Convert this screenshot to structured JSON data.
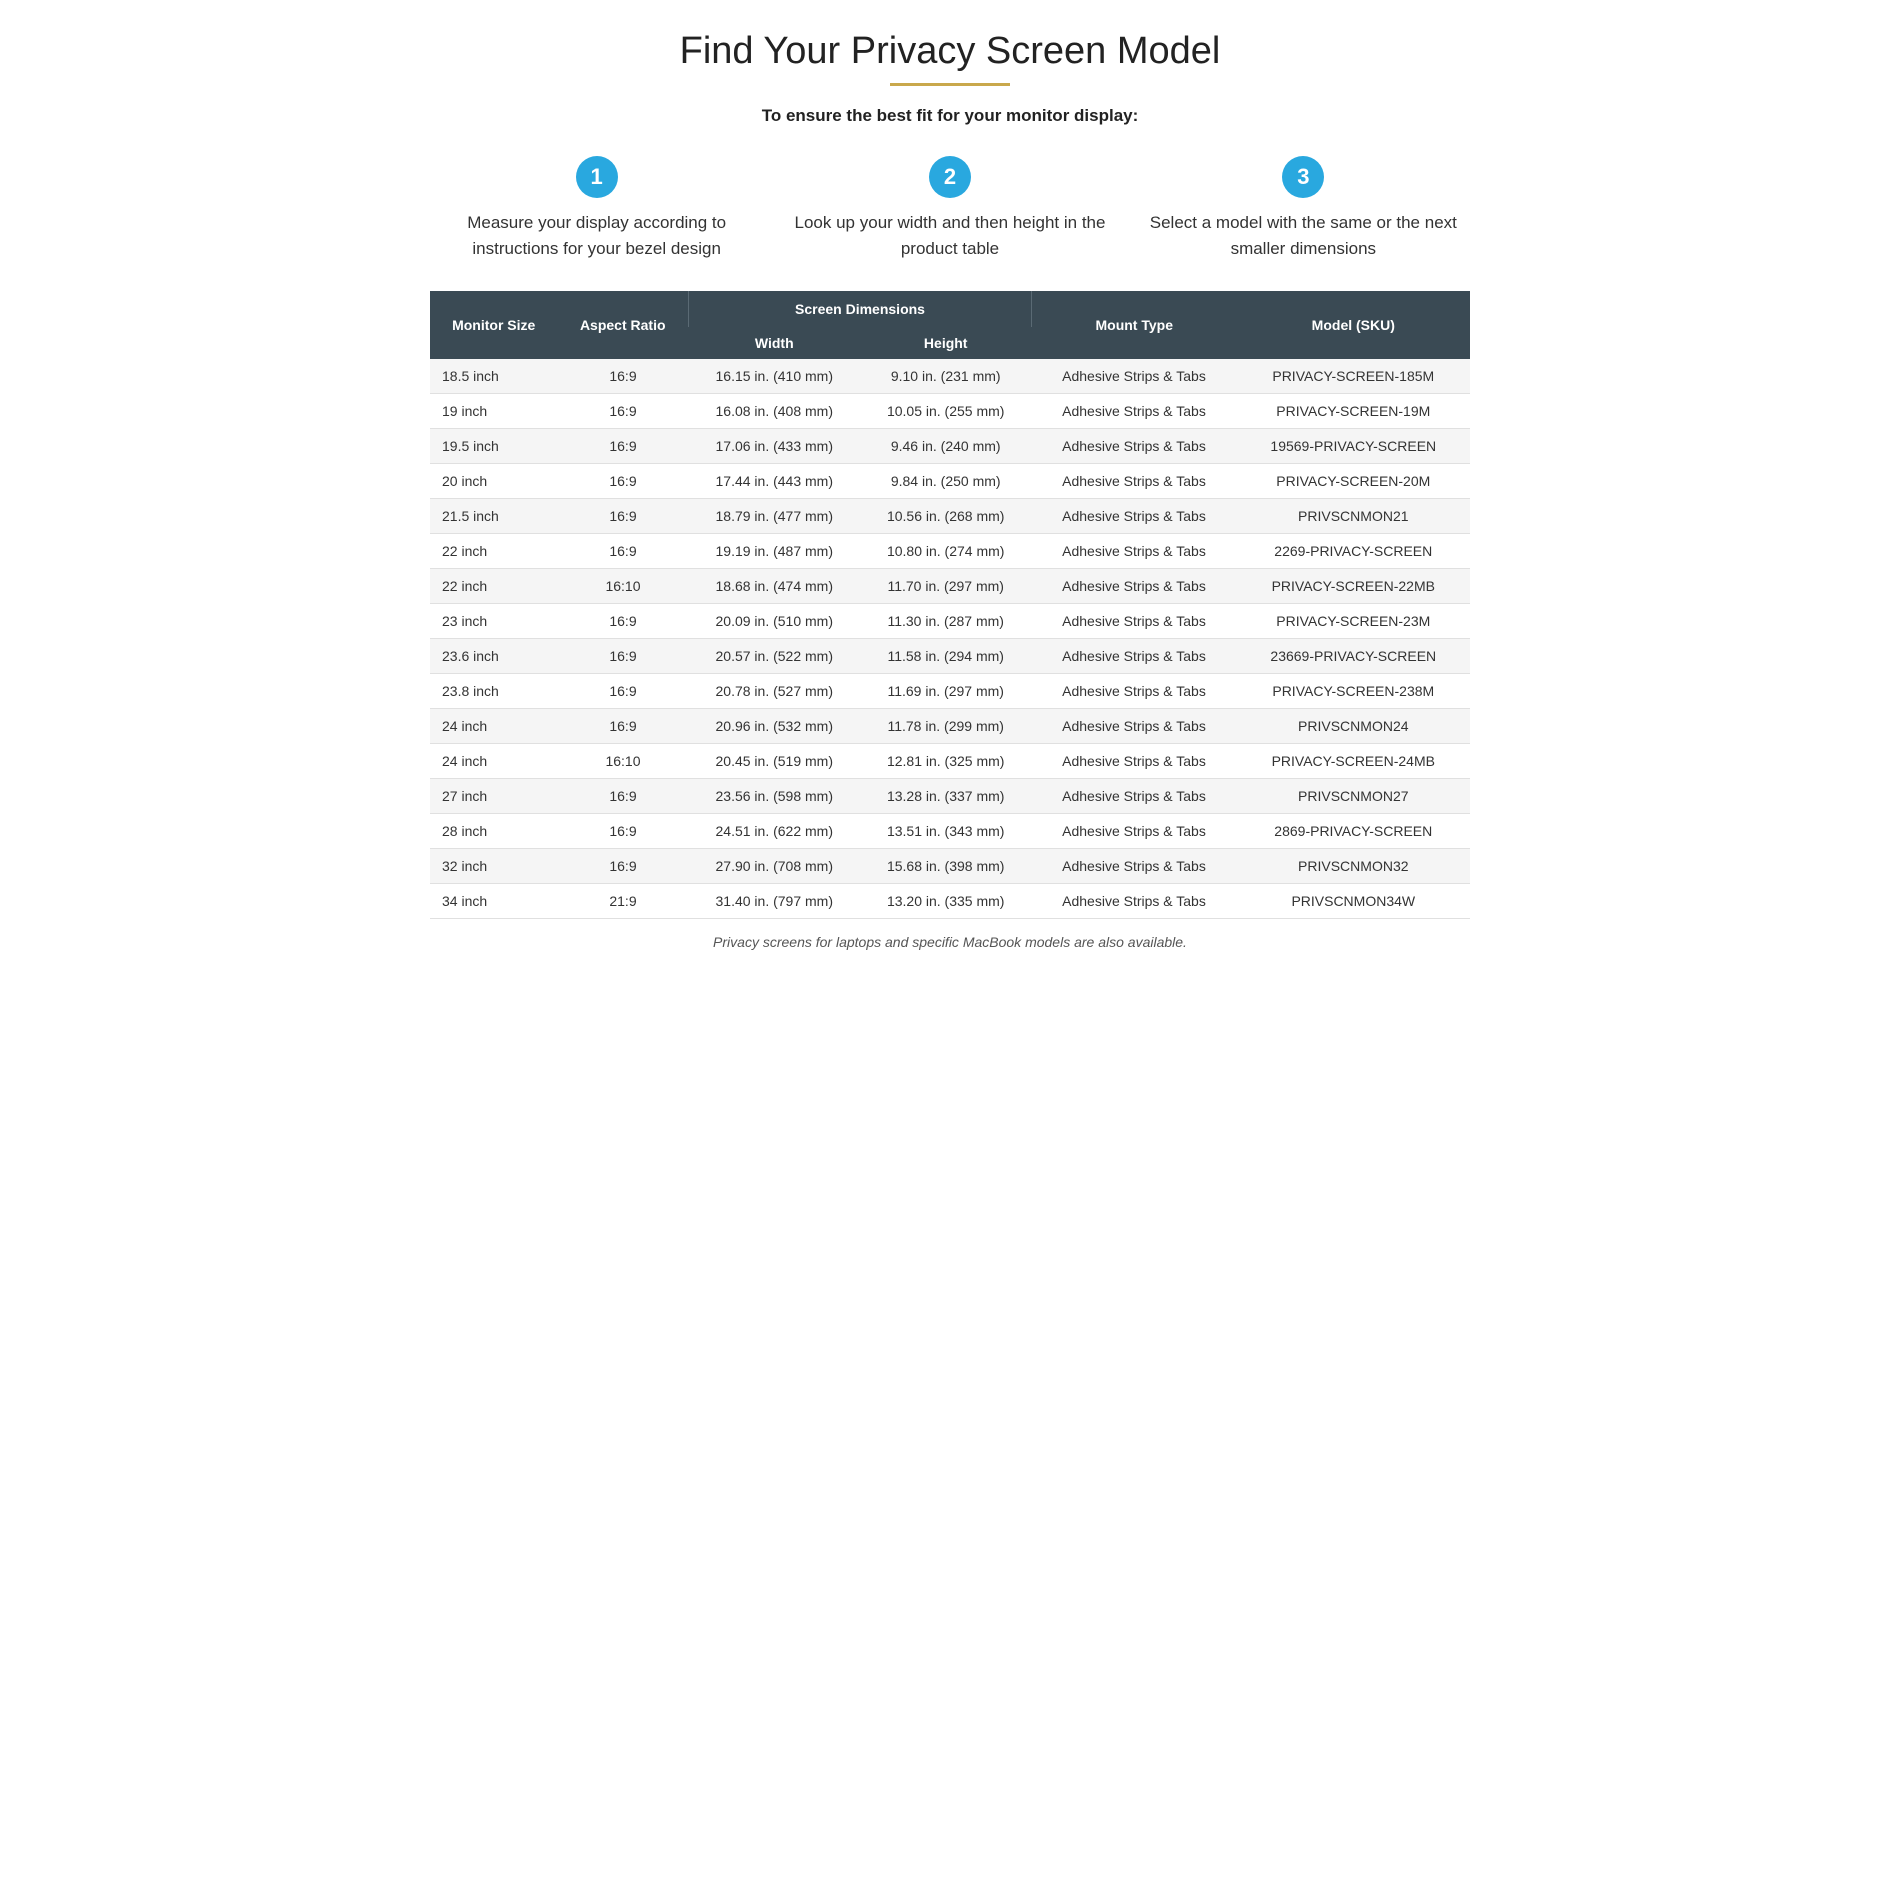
{
  "page": {
    "title": "Find Your Privacy Screen Model",
    "subtitle": "To ensure the best fit for your monitor display:",
    "divider": true
  },
  "steps": [
    {
      "number": "1",
      "text": "Measure your display according to instructions for your bezel design"
    },
    {
      "number": "2",
      "text": "Look up your width and then height in the product table"
    },
    {
      "number": "3",
      "text": "Select a model with the same or the next smaller dimensions"
    }
  ],
  "table": {
    "headers": {
      "col1": "Monitor Size",
      "col2": "Aspect Ratio",
      "screen_dims": "Screen Dimensions",
      "col_width": "Width",
      "col_height": "Height",
      "col_mount": "Mount Type",
      "col_model": "Model (SKU)"
    },
    "rows": [
      {
        "size": "18.5 inch",
        "ratio": "16:9",
        "width": "16.15 in. (410 mm)",
        "height": "9.10 in. (231 mm)",
        "mount": "Adhesive Strips & Tabs",
        "model": "PRIVACY-SCREEN-185M"
      },
      {
        "size": "19 inch",
        "ratio": "16:9",
        "width": "16.08 in. (408 mm)",
        "height": "10.05 in. (255 mm)",
        "mount": "Adhesive Strips & Tabs",
        "model": "PRIVACY-SCREEN-19M"
      },
      {
        "size": "19.5 inch",
        "ratio": "16:9",
        "width": "17.06 in. (433 mm)",
        "height": "9.46 in. (240 mm)",
        "mount": "Adhesive Strips & Tabs",
        "model": "19569-PRIVACY-SCREEN"
      },
      {
        "size": "20 inch",
        "ratio": "16:9",
        "width": "17.44 in. (443 mm)",
        "height": "9.84 in. (250 mm)",
        "mount": "Adhesive Strips & Tabs",
        "model": "PRIVACY-SCREEN-20M"
      },
      {
        "size": "21.5 inch",
        "ratio": "16:9",
        "width": "18.79 in. (477 mm)",
        "height": "10.56 in. (268 mm)",
        "mount": "Adhesive Strips & Tabs",
        "model": "PRIVSCNMON21"
      },
      {
        "size": "22 inch",
        "ratio": "16:9",
        "width": "19.19 in. (487 mm)",
        "height": "10.80 in. (274 mm)",
        "mount": "Adhesive Strips & Tabs",
        "model": "2269-PRIVACY-SCREEN"
      },
      {
        "size": "22 inch",
        "ratio": "16:10",
        "width": "18.68 in. (474 mm)",
        "height": "11.70 in. (297 mm)",
        "mount": "Adhesive Strips & Tabs",
        "model": "PRIVACY-SCREEN-22MB"
      },
      {
        "size": "23 inch",
        "ratio": "16:9",
        "width": "20.09 in. (510 mm)",
        "height": "11.30 in. (287 mm)",
        "mount": "Adhesive Strips & Tabs",
        "model": "PRIVACY-SCREEN-23M"
      },
      {
        "size": "23.6 inch",
        "ratio": "16:9",
        "width": "20.57 in. (522 mm)",
        "height": "11.58 in. (294 mm)",
        "mount": "Adhesive Strips & Tabs",
        "model": "23669-PRIVACY-SCREEN"
      },
      {
        "size": "23.8 inch",
        "ratio": "16:9",
        "width": "20.78 in. (527 mm)",
        "height": "11.69 in. (297 mm)",
        "mount": "Adhesive Strips & Tabs",
        "model": "PRIVACY-SCREEN-238M"
      },
      {
        "size": "24 inch",
        "ratio": "16:9",
        "width": "20.96 in. (532 mm)",
        "height": "11.78 in. (299 mm)",
        "mount": "Adhesive Strips & Tabs",
        "model": "PRIVSCNMON24"
      },
      {
        "size": "24 inch",
        "ratio": "16:10",
        "width": "20.45 in. (519 mm)",
        "height": "12.81 in. (325 mm)",
        "mount": "Adhesive Strips & Tabs",
        "model": "PRIVACY-SCREEN-24MB"
      },
      {
        "size": "27 inch",
        "ratio": "16:9",
        "width": "23.56 in. (598 mm)",
        "height": "13.28 in. (337 mm)",
        "mount": "Adhesive Strips & Tabs",
        "model": "PRIVSCNMON27"
      },
      {
        "size": "28 inch",
        "ratio": "16:9",
        "width": "24.51 in. (622 mm)",
        "height": "13.51 in. (343 mm)",
        "mount": "Adhesive Strips & Tabs",
        "model": "2869-PRIVACY-SCREEN"
      },
      {
        "size": "32 inch",
        "ratio": "16:9",
        "width": "27.90 in. (708 mm)",
        "height": "15.68 in. (398 mm)",
        "mount": "Adhesive Strips & Tabs",
        "model": "PRIVSCNMON32"
      },
      {
        "size": "34 inch",
        "ratio": "21:9",
        "width": "31.40 in. (797 mm)",
        "height": "13.20 in. (335 mm)",
        "mount": "Adhesive Strips & Tabs",
        "model": "PRIVSCNMON34W"
      }
    ]
  },
  "footer": "Privacy screens for laptops and specific MacBook models are also available."
}
